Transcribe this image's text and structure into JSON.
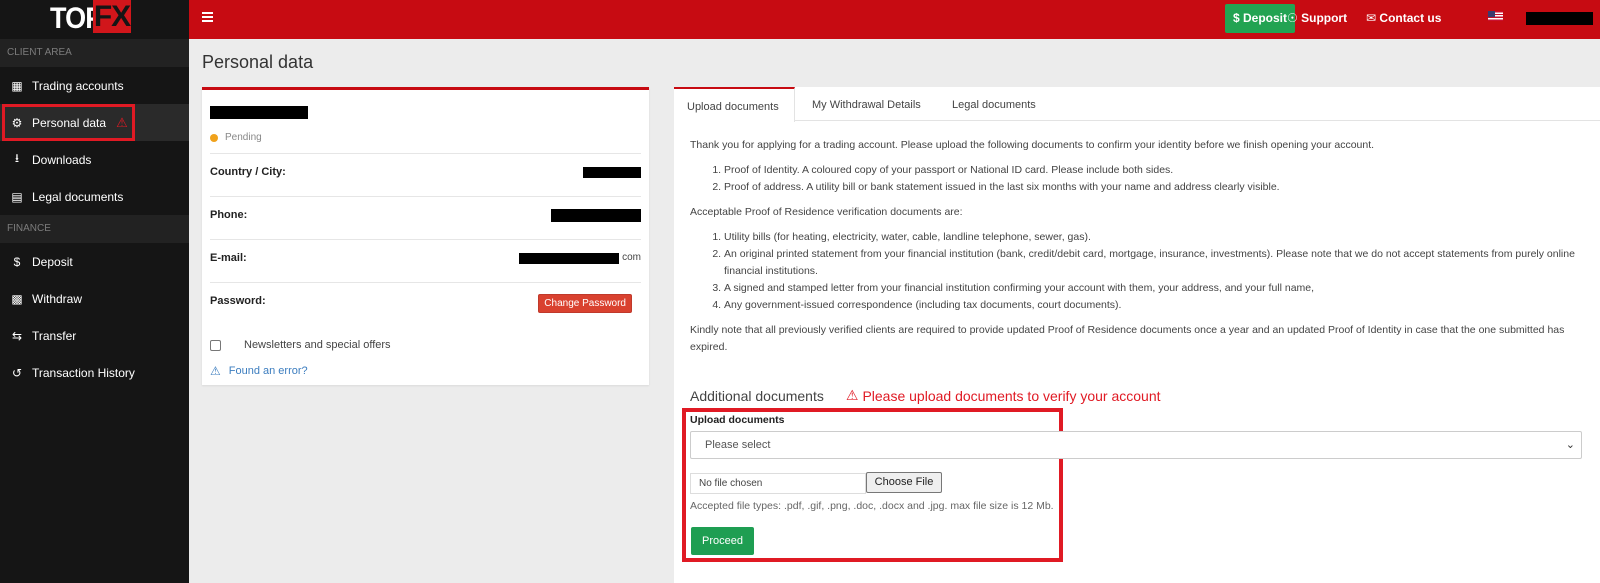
{
  "brand": {
    "logo_left": "TOP",
    "logo_right": "FX"
  },
  "sidebar": {
    "sections": [
      {
        "header": "CLIENT AREA"
      },
      {
        "header": "FINANCE"
      }
    ],
    "items": [
      {
        "label": "Trading accounts",
        "icon": "dashboard-icon"
      },
      {
        "label": "Personal data",
        "icon": "gear-icon",
        "active": true
      },
      {
        "label": "Downloads",
        "icon": "download-icon"
      },
      {
        "label": "Legal documents",
        "icon": "book-icon"
      },
      {
        "label": "Deposit",
        "icon": "dollar-icon"
      },
      {
        "label": "Withdraw",
        "icon": "cash-icon"
      },
      {
        "label": "Transfer",
        "icon": "exchange-icon"
      },
      {
        "label": "Transaction History",
        "icon": "history-icon"
      }
    ]
  },
  "topbar": {
    "deposit_label": "$ Deposit",
    "support_label": "Support",
    "contact_label": "Contact us"
  },
  "page": {
    "title": "Personal data"
  },
  "profile": {
    "status": "Pending",
    "country_label": "Country / City:",
    "phone_label": "Phone:",
    "email_label": "E-mail:",
    "email_suffix": "com",
    "password_label": "Password:",
    "change_password_label": "Change Password",
    "newsletter_label": "Newsletters and special offers",
    "found_error_label": "Found an error?"
  },
  "tabs": [
    {
      "label": "Upload documents",
      "active": true
    },
    {
      "label": "My Withdrawal Details"
    },
    {
      "label": "Legal documents"
    }
  ],
  "docs": {
    "intro": "Thank you for applying for a trading account. Please upload the following documents to confirm your identity before we finish opening your account.",
    "required": [
      "Proof of Identity. A coloured copy of your passport or National ID card. Please include both sides.",
      "Proof of address. A utility bill or bank statement issued in the last six months with your name and address clearly visible."
    ],
    "residence_intro": "Acceptable Proof of Residence verification documents are:",
    "residence": [
      "Utility bills (for heating, electricity, water, cable, landline telephone, sewer, gas).",
      "An original printed statement from your financial institution (bank, credit/debit card, mortgage, insurance, investments). Please note that we do not accept statements from purely online financial institutions.",
      "A signed and stamped letter from your financial institution confirming your account with them, your address, and your full name,",
      "Any government-issued correspondence (including tax documents, court documents)."
    ],
    "note": "Kindly note that all previously verified clients are required to provide updated Proof of Residence documents once a year and an updated Proof of Identity in case that the one submitted has expired.",
    "additional_heading": "Additional documents",
    "warning": "Please upload documents to verify your account",
    "upload_label": "Upload documents",
    "select_value": "Please select",
    "file_status": "No file chosen",
    "choose_file_label": "Choose File",
    "accepted_types": "Accepted file types: .pdf, .gif, .png, .doc, .docx and .jpg. max file size is 12 Mb.",
    "proceed_label": "Proceed"
  }
}
